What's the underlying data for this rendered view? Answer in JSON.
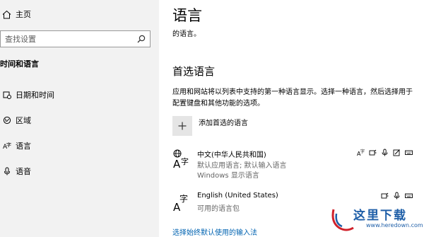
{
  "nav": {
    "home_label": "主页",
    "search_placeholder": "查找设置",
    "section_title": "时间和语言",
    "items": [
      {
        "label": "日期和时间",
        "icon": "calendar-clock-icon"
      },
      {
        "label": "区域",
        "icon": "region-globe-icon"
      },
      {
        "label": "语言",
        "icon": "language-icon"
      },
      {
        "label": "语音",
        "icon": "microphone-icon"
      }
    ]
  },
  "content": {
    "title": "语言",
    "subtitle": "的语言。",
    "preferred_heading": "首选语言",
    "description": "应用和网站将以列表中支持的第一种语言显示。选择一种语言，然后选择用于配置键盘和其他功能的选项。",
    "add_label": "添加首选的语言",
    "languages": [
      {
        "name": "中文(中华人民共和国)",
        "lines": [
          "默认应用语言; 默认输入语言",
          "Windows 显示语言"
        ],
        "features": [
          "display-language-icon",
          "text-to-speech-icon",
          "speech-recognition-icon",
          "handwriting-icon",
          "keyboard-icon"
        ]
      },
      {
        "name": "English (United States)",
        "lines": [
          "可用的语言包"
        ],
        "features": [
          "text-to-speech-icon",
          "speech-recognition-icon",
          "keyboard-icon"
        ]
      }
    ],
    "link": "选择始终默认使用的输入法"
  },
  "watermark": {
    "text": "这里下载",
    "url": "www.heredown.com"
  },
  "colors": {
    "nav_bg": "#f2f2f2",
    "link": "#0063b1",
    "watermark_blue": "#1f5fa8",
    "watermark_red": "#d0202a"
  }
}
